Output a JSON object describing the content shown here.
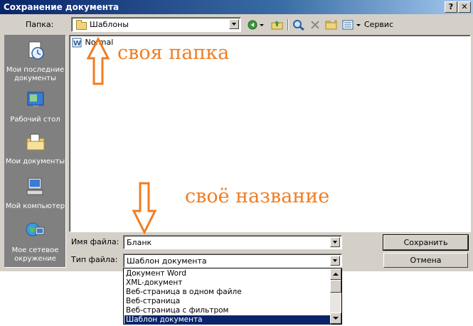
{
  "window": {
    "title": "Сохранение документа",
    "help_label": "?",
    "close_label": "✕"
  },
  "folder": {
    "label": "Папка:",
    "value": "Шаблоны"
  },
  "toolbar": {
    "service_label": "Сервис",
    "icons": [
      "back-icon",
      "up-folder-icon",
      "search-web-icon",
      "delete-icon",
      "new-folder-icon",
      "views-icon"
    ]
  },
  "places": [
    {
      "label": "Мои последние документы",
      "icon": "recent-documents-icon"
    },
    {
      "label": "Рабочий стол",
      "icon": "desktop-icon"
    },
    {
      "label": "Мои документы",
      "icon": "my-documents-icon"
    },
    {
      "label": "Мой компьютер",
      "icon": "my-computer-icon"
    },
    {
      "label": "Мое сетевое окружение",
      "icon": "network-places-icon"
    }
  ],
  "files": [
    {
      "name": "Normal",
      "icon": "word-document-icon"
    }
  ],
  "filename": {
    "label": "Имя файла:",
    "value": "Бланк"
  },
  "filetype": {
    "label": "Тип файла:",
    "value": "Шаблон документа",
    "options": [
      "Документ Word",
      "XML-документ",
      "Веб-страница в одном файле",
      "Веб-страница",
      "Веб-страница с фильтром",
      "Шаблон документа"
    ],
    "selected_index": 5
  },
  "buttons": {
    "save": "Сохранить",
    "cancel": "Отмена"
  },
  "annotations": {
    "folder_note": "своя папка",
    "name_note": "своё название",
    "color": "#f07d22"
  }
}
